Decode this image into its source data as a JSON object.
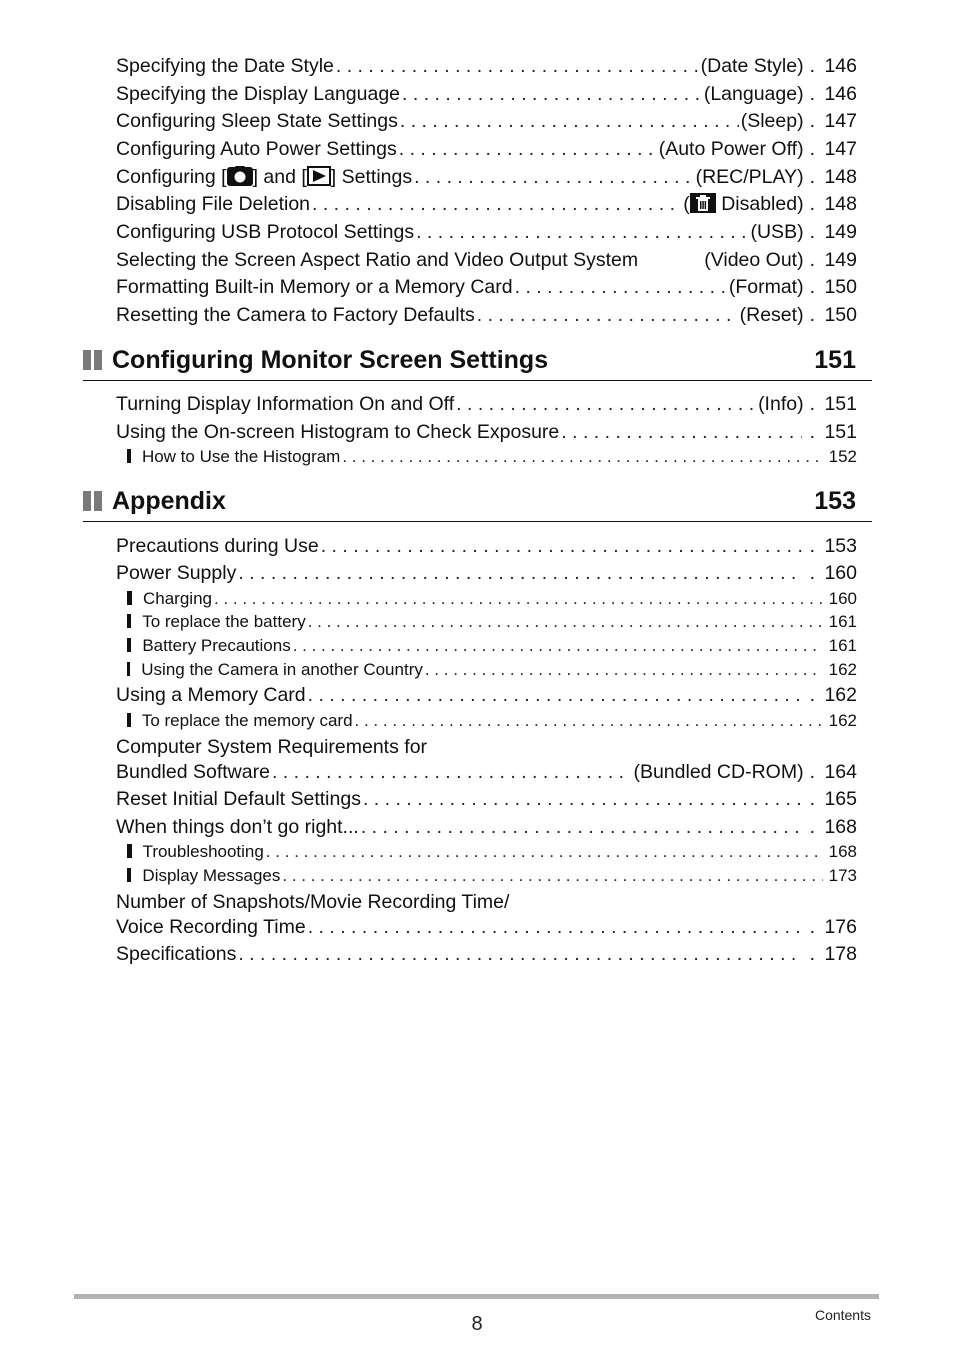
{
  "top_entries": [
    {
      "title": "Specifying the Date Style",
      "note": "(Date Style)",
      "page": "146"
    },
    {
      "title": "Specifying the Display Language",
      "note": "(Language)",
      "page": "146"
    },
    {
      "title": "Configuring Sleep State Settings",
      "note": "(Sleep)",
      "page": "147"
    },
    {
      "title": "Configuring Auto Power Settings",
      "note": "(Auto Power Off)",
      "page": "147"
    },
    {
      "title_parts": [
        "Configuring [",
        "] and [",
        "] Settings"
      ],
      "icons": [
        "camera-icon",
        "play-icon"
      ],
      "note": "(REC/PLAY)",
      "page": "148"
    },
    {
      "title": "Disabling File Deletion",
      "note_icon": "trash-icon",
      "note_open": "(",
      "note": " Disabled)",
      "page": "148"
    },
    {
      "title": "Configuring USB Protocol Settings",
      "note": "(USB)",
      "page": "149"
    },
    {
      "title": "Selecting the Screen Aspect Ratio and Video Output System",
      "note": "(Video Out)",
      "page": "149"
    },
    {
      "title": "Formatting Built-in Memory or a Memory Card",
      "note": "(Format)",
      "page": "150"
    },
    {
      "title": "Resetting the Camera to Factory Defaults",
      "note": "(Reset)",
      "page": "150"
    }
  ],
  "sections": [
    {
      "title": "Configuring Monitor Screen Settings",
      "page": "151",
      "entries": [
        {
          "title": "Turning Display Information On and Off",
          "note": "(Info)",
          "page": "151"
        },
        {
          "title": "Using the On-screen Histogram to Check Exposure",
          "note": "",
          "page": "151"
        },
        {
          "title": "How to Use the Histogram",
          "page": "152",
          "sub": true
        }
      ]
    },
    {
      "title": "Appendix",
      "page": "153",
      "entries": [
        {
          "title": "Precautions during Use",
          "page": "153"
        },
        {
          "title": "Power Supply",
          "page": "160"
        },
        {
          "title": "Charging",
          "page": "160",
          "sub": true
        },
        {
          "title": "To replace the battery",
          "page": "161",
          "sub": true
        },
        {
          "title": "Battery Precautions",
          "page": "161",
          "sub": true
        },
        {
          "title": "Using the Camera in another Country",
          "page": "162",
          "sub": true
        },
        {
          "title": "Using a Memory Card",
          "page": "162"
        },
        {
          "title": "To replace the memory card",
          "page": "162",
          "sub": true
        },
        {
          "title_line1": "Computer System Requirements for",
          "title": "Bundled Software",
          "note": "(Bundled CD-ROM)",
          "page": "164"
        },
        {
          "title": "Reset Initial Default Settings",
          "page": "165"
        },
        {
          "title": "When things don’t go right...",
          "page": "168"
        },
        {
          "title": "Troubleshooting",
          "page": "168",
          "sub": true
        },
        {
          "title": "Display Messages",
          "page": "173",
          "sub": true
        },
        {
          "title_line1": "Number of Snapshots/Movie Recording Time/",
          "title": "Voice Recording Time",
          "page": "176"
        },
        {
          "title": "Specifications",
          "page": "178"
        }
      ]
    }
  ],
  "footer": {
    "page_number": "8",
    "label": "Contents"
  }
}
